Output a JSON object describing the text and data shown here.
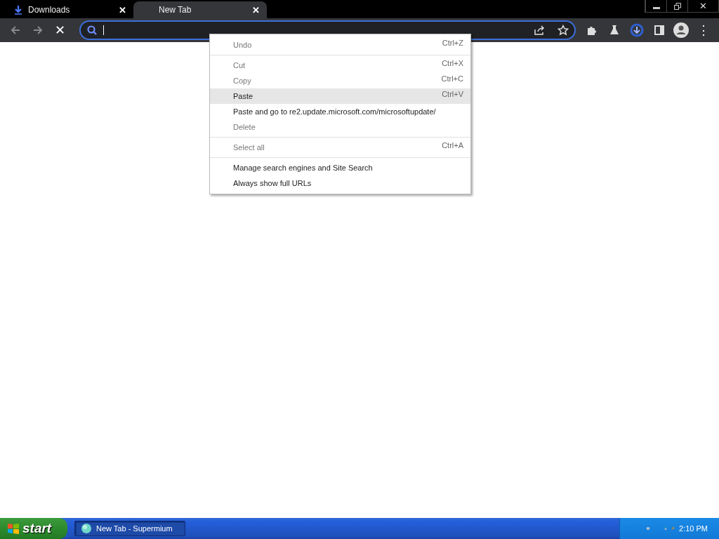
{
  "tabs": [
    {
      "title": "Downloads",
      "selected": false,
      "close": "✕"
    },
    {
      "title": "New Tab",
      "selected": true,
      "close": "✕"
    }
  ],
  "window_controls": {
    "close": "✕"
  },
  "toolbar": {
    "stop": "✕",
    "menu": "⋮"
  },
  "omnibox": {
    "focused": true
  },
  "context_menu": {
    "groups": [
      [
        {
          "label": "Undo",
          "shortcut": "Ctrl+Z",
          "disabled": true,
          "selected": false
        }
      ],
      [
        {
          "label": "Cut",
          "shortcut": "Ctrl+X",
          "disabled": true,
          "selected": false
        },
        {
          "label": "Copy",
          "shortcut": "Ctrl+C",
          "disabled": true,
          "selected": false
        },
        {
          "label": "Paste",
          "shortcut": "Ctrl+V",
          "disabled": false,
          "selected": true
        },
        {
          "label": "Paste and go to re2.update.microsoft.com/microsoftupdate/",
          "disabled": false,
          "selected": false
        },
        {
          "label": "Delete",
          "disabled": true,
          "selected": false
        }
      ],
      [
        {
          "label": "Select all",
          "shortcut": "Ctrl+A",
          "disabled": true,
          "selected": false
        }
      ],
      [
        {
          "label": "Manage search engines and Site Search",
          "disabled": false,
          "selected": false
        },
        {
          "label": "Always show full URLs",
          "disabled": false,
          "selected": false
        }
      ]
    ]
  },
  "taskbar": {
    "start": "start",
    "tasks": [
      {
        "label": "New Tab - Supermium",
        "selected": true
      }
    ],
    "clock": "2:10 PM"
  }
}
